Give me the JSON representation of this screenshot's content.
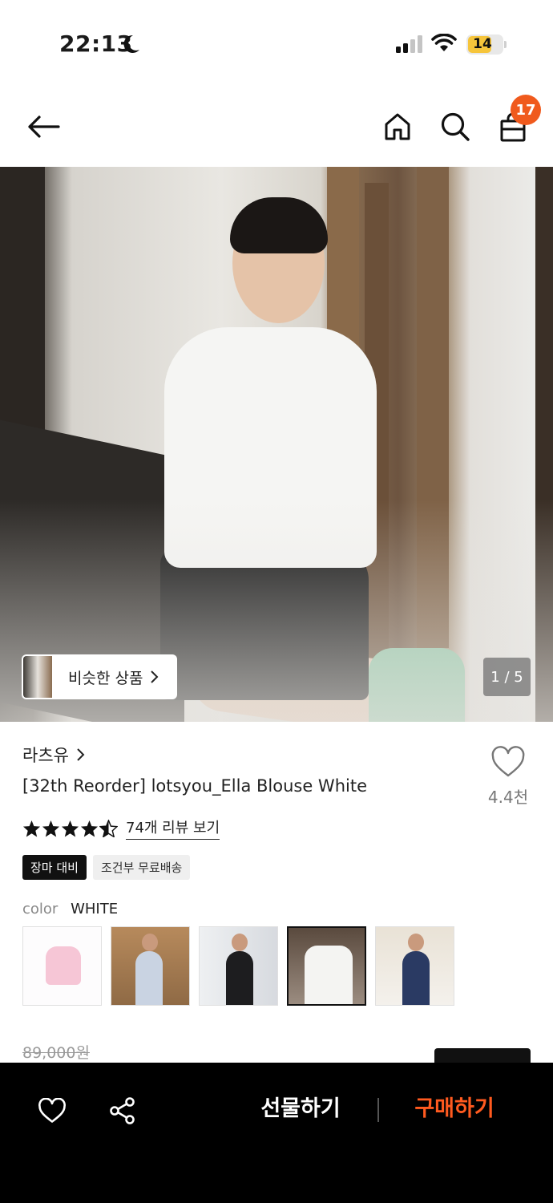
{
  "status_bar": {
    "time": "22:13",
    "battery": "14"
  },
  "nav": {
    "cart_badge": "17",
    "icons": [
      "back-arrow-icon",
      "home-icon",
      "search-icon",
      "shopping-bag-icon"
    ]
  },
  "hero": {
    "similar_label": "비슷한 상품",
    "page_indicator": "1 / 5"
  },
  "product": {
    "brand": "라츠유",
    "title": "[32th Reorder] lotsyou_Ella Blouse White",
    "like_count": "4.4천",
    "rating_stars": 4.5,
    "review_link": "74개 리뷰 보기",
    "tags": [
      "장마 대비",
      "조건부 무료배송"
    ],
    "color_label": "color",
    "color_value": "WHITE",
    "swatches": [
      {
        "name": "pink",
        "selected": false
      },
      {
        "name": "floral",
        "selected": false
      },
      {
        "name": "black",
        "selected": false
      },
      {
        "name": "white",
        "selected": true
      },
      {
        "name": "navy",
        "selected": false
      }
    ],
    "original_price": "89,000원"
  },
  "bottom_bar": {
    "gift_label": "선물하기",
    "buy_label": "구매하기",
    "colors": {
      "buy": "#ff5a1f",
      "badge": "#f05a1d"
    }
  }
}
